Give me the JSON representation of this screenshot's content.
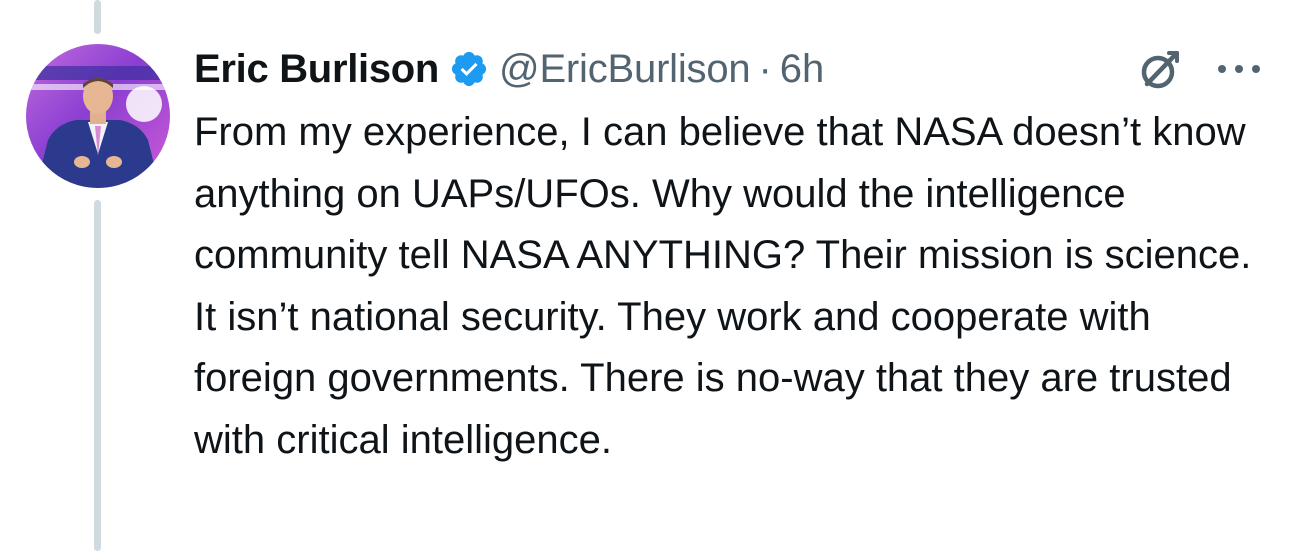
{
  "tweet": {
    "author_name": "Eric Burlison",
    "handle": "@EricBurlison",
    "separator": "·",
    "time": "6h",
    "verified": true,
    "text": "From my experience, I can believe that NASA doesn’t know anything on UAPs/UFOs. Why would the intelligence community tell NASA ANYTHING? Their mission is science. It isn’t national security. They work and cooperate with foreign governments. There is no-way that they are trusted with critical intelligence."
  },
  "icons": {
    "verified": "verified-badge-icon",
    "grok": "grok-icon",
    "more": "more-options-icon"
  },
  "colors": {
    "text_primary": "#0f1419",
    "text_secondary": "#536471",
    "verified_blue": "#1d9bf0",
    "thread_line": "#cfd9de"
  }
}
